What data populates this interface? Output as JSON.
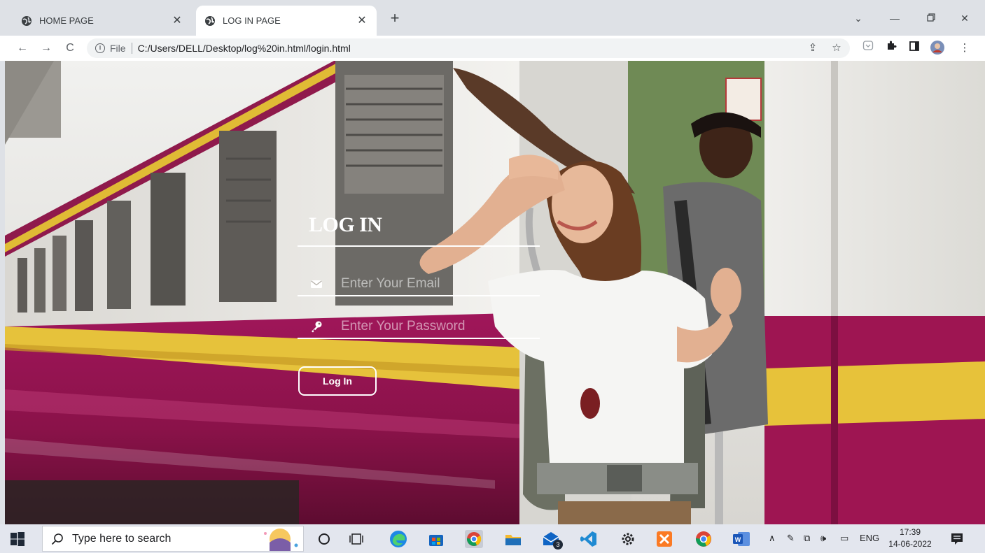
{
  "browser": {
    "tabs": [
      {
        "title": "HOME PAGE",
        "active": false
      },
      {
        "title": "LOG IN PAGE",
        "active": true
      }
    ],
    "address": {
      "scheme_label": "File",
      "url": "C:/Users/DELL/Desktop/log%20in.html/login.html"
    }
  },
  "login": {
    "title": "LOG IN",
    "email_placeholder": "Enter Your Email",
    "password_placeholder": "Enter Your Password",
    "button_label": "Log In"
  },
  "taskbar": {
    "search_placeholder": "Type here to search",
    "mail_badge": "3",
    "language": "ENG",
    "time": "17:39",
    "date": "14-06-2022"
  },
  "colors": {
    "train_maroon": "#9c1450",
    "train_yellow": "#e7c23a",
    "window_white": "#ffffff"
  }
}
